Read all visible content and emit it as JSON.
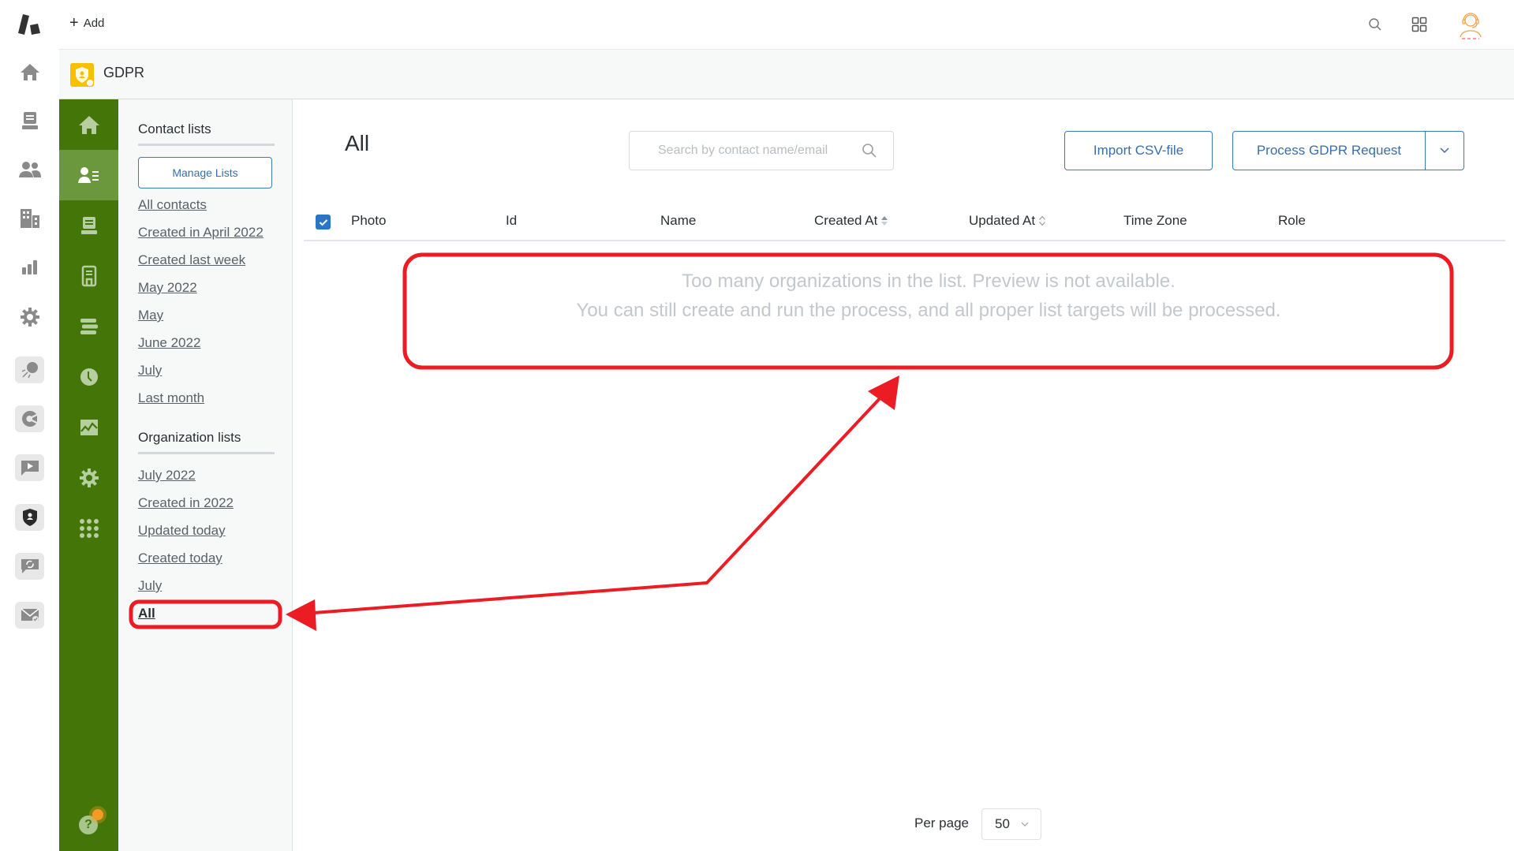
{
  "topbar": {
    "add_label": "Add",
    "icons": [
      "search-icon",
      "apps-grid-icon",
      "user-avatar-icon"
    ]
  },
  "rail": {
    "items": [
      {
        "icon": "home-icon"
      },
      {
        "icon": "inbox-icon"
      },
      {
        "icon": "contacts-icon"
      },
      {
        "icon": "organizations-icon"
      },
      {
        "icon": "reports-icon"
      },
      {
        "icon": "settings-icon"
      },
      {
        "icon": "marketing-icon"
      },
      {
        "icon": "analytics-icon"
      },
      {
        "icon": "video-icon"
      },
      {
        "icon": "gdpr-shield-icon",
        "active": true
      },
      {
        "icon": "sync-chat-icon"
      },
      {
        "icon": "email-verify-icon"
      }
    ]
  },
  "app": {
    "title": "GDPR",
    "accent": "#437508",
    "logo_color": "#f7c100"
  },
  "greennav": {
    "items": [
      {
        "icon": "home-icon"
      },
      {
        "icon": "contact-lists-icon",
        "active": true
      },
      {
        "icon": "inbox-icon"
      },
      {
        "icon": "document-icon"
      },
      {
        "icon": "list-icon"
      },
      {
        "icon": "clock-icon"
      },
      {
        "icon": "chart-icon"
      },
      {
        "icon": "settings-icon"
      },
      {
        "icon": "apps-icon"
      }
    ],
    "help_label": "?"
  },
  "lists": {
    "contact_heading": "Contact lists",
    "manage_label": "Manage Lists",
    "contact_lists": [
      "All contacts",
      "Created in April 2022",
      "Created last week",
      "May 2022",
      "May",
      "June 2022",
      "July",
      "Last month"
    ],
    "org_heading": "Organization lists",
    "org_lists": [
      "July 2022",
      "Created in 2022",
      "Updated today",
      "Created today",
      "July",
      "All"
    ],
    "selected": "All"
  },
  "main": {
    "title": "All",
    "search_placeholder": "Search by contact name/email",
    "search_value": "",
    "import_label": "Import CSV-file",
    "process_label": "Process GDPR Request",
    "columns": [
      {
        "label": "Photo"
      },
      {
        "label": "Id"
      },
      {
        "label": "Name"
      },
      {
        "label": "Created At",
        "sort": "sorted"
      },
      {
        "label": "Updated At",
        "sort": "unsorted"
      },
      {
        "label": "Time Zone"
      },
      {
        "label": "Role"
      }
    ],
    "select_all_checked": true,
    "empty_line1": "Too many organizations in the list. Preview is not available.",
    "empty_line2": "You can still create and run the process, and all proper list targets will be processed.",
    "per_page_label": "Per page",
    "per_page_value": "50"
  },
  "annotation": {
    "color": "#ec1c24"
  }
}
